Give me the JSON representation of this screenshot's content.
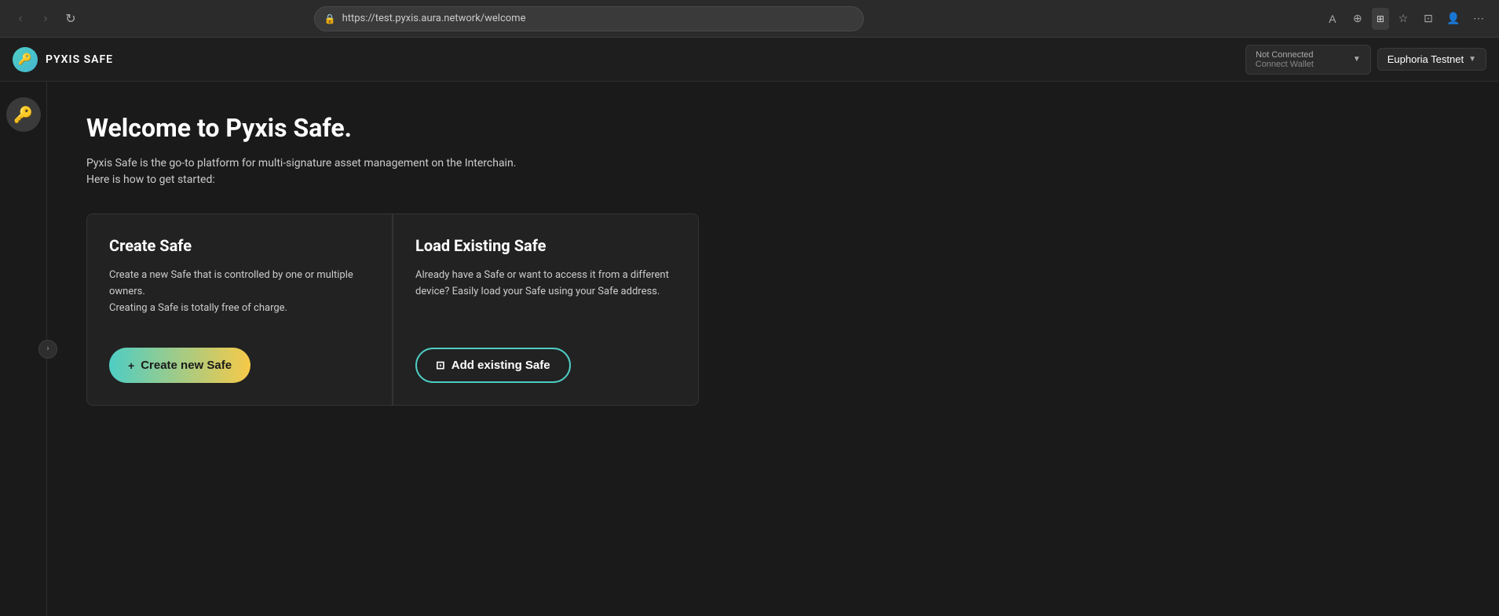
{
  "browser": {
    "url": "https://test.pyxis.aura.network/welcome",
    "back_btn": "‹",
    "forward_btn": "›",
    "reload_btn": "↻"
  },
  "header": {
    "logo_icon": "🔑",
    "logo_text": "PYXIS SAFE",
    "wallet_status_label": "Not Connected",
    "wallet_status_sub": "Connect Wallet",
    "network_label": "Euphoria Testnet",
    "expand_icon": "›"
  },
  "sidebar": {
    "avatar_icon": "🔑",
    "expand_icon": "›"
  },
  "main": {
    "title": "Welcome to Pyxis Safe.",
    "subtitle_line1": "Pyxis Safe is the go-to platform for multi-signature asset management on the Interchain.",
    "subtitle_line2": "Here is how to get started:",
    "cards": [
      {
        "title": "Create Safe",
        "description": "Create a new Safe that is controlled by one or multiple owners.\nCreating a Safe is totally free of charge.",
        "button_label": "Create new Safe",
        "button_icon": "+"
      },
      {
        "title": "Load Existing Safe",
        "description": "Already have a Safe or want to access it from a different device? Easily load your Safe using your Safe address.",
        "button_label": "Add existing Safe",
        "button_icon": "⊡"
      }
    ]
  }
}
